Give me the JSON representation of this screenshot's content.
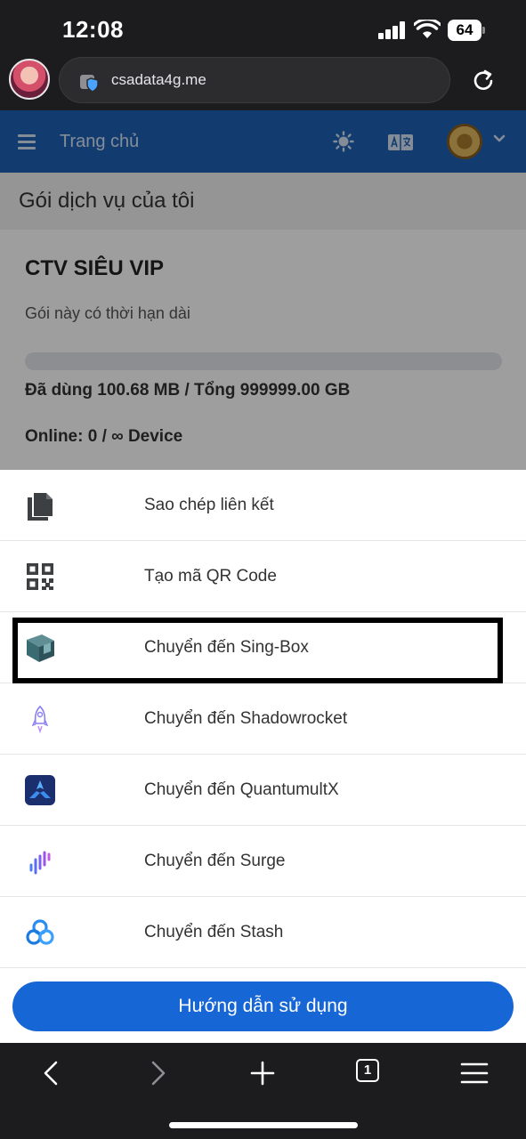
{
  "status": {
    "time": "12:08",
    "battery": "64"
  },
  "browser": {
    "url": "csadata4g.me"
  },
  "navbar": {
    "title": "Trang chủ"
  },
  "page": {
    "heading": "Gói dịch vụ của tôi"
  },
  "plan": {
    "name": "CTV SIÊU VIP",
    "description": "Gói này có thời hạn dài",
    "usage_text": "Đã dùng 100.68 MB / Tổng 999999.00 GB",
    "usage_fraction": 1e-07,
    "online_text": "Online: 0 / ∞ Device"
  },
  "menu": {
    "items": [
      {
        "label": "Sao chép liên kết",
        "icon": "copy-icon"
      },
      {
        "label": "Tạo mã QR Code",
        "icon": "qr-code-icon"
      },
      {
        "label": "Chuyển đến Sing-Box",
        "icon": "sing-box-icon"
      },
      {
        "label": "Chuyển đến Shadowrocket",
        "icon": "shadowrocket-icon"
      },
      {
        "label": "Chuyển đến QuantumultX",
        "icon": "quantumultx-icon"
      },
      {
        "label": "Chuyển đến Surge",
        "icon": "surge-icon"
      },
      {
        "label": "Chuyển đến Stash",
        "icon": "stash-icon"
      }
    ],
    "guide_button": "Hướng dẫn sử dụng"
  },
  "toolbar": {
    "tab_count": "1"
  },
  "colors": {
    "navbar": "#1e62b3",
    "button": "#1766d6",
    "highlight_border": "#000000"
  }
}
